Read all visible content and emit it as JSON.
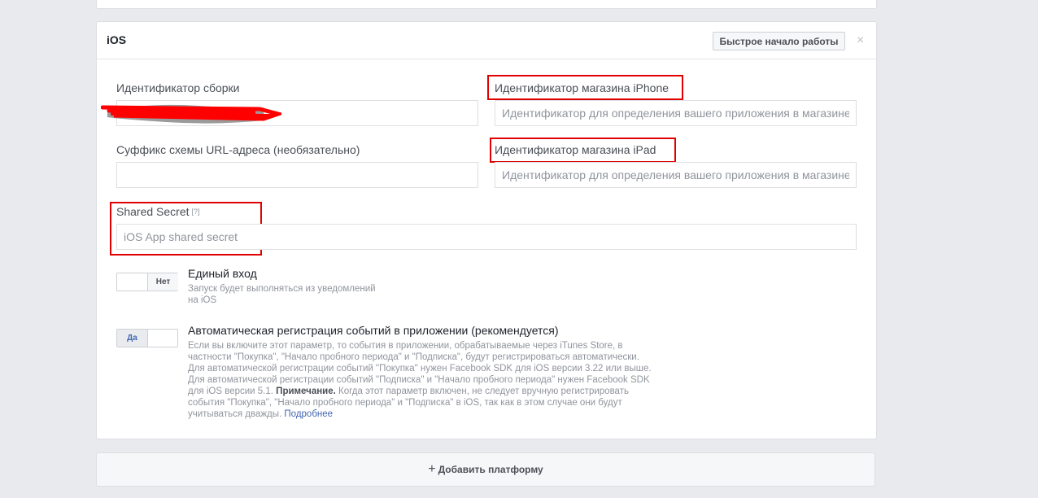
{
  "platform": {
    "title": "iOS",
    "quickstart_label": "Быстрое начало работы",
    "close_glyph": "×"
  },
  "fields": {
    "bundle_id": {
      "label": "Идентификатор сборки",
      "value": ""
    },
    "iphone_store_id": {
      "label": "Идентификатор магазина iPhone",
      "placeholder": "Идентификатор для определения вашего приложения в магазине"
    },
    "url_scheme_suffix": {
      "label": "Суффикс схемы URL-адреса (необязательно)",
      "value": ""
    },
    "ipad_store_id": {
      "label": "Идентификатор магазина iPad",
      "placeholder": "Идентификатор для определения вашего приложения в магазине"
    },
    "shared_secret": {
      "label": "Shared Secret",
      "help": "[?]",
      "placeholder": "iOS App shared secret"
    }
  },
  "single_sign_on": {
    "toggle_label": "Нет",
    "state": "off",
    "title": "Единый вход",
    "desc_line1": "Запуск будет выполняться из уведомлений",
    "desc_line2": "на iOS"
  },
  "auto_log_events": {
    "toggle_label": "Да",
    "state": "on",
    "title": "Автоматическая регистрация событий в приложении (рекомендуется)",
    "desc_lines": [
      "Если вы включите этот параметр, то события в приложении, обрабатываемые через iTunes Store, в",
      "частности \"Покупка\", \"Начало пробного периода\" и \"Подписка\", будут регистрироваться автоматически.",
      "Для автоматической регистрации событий \"Покупка\" нужен Facebook SDK для iOS версии 3.22 или выше.",
      "Для автоматической регистрации событий \"Подписка\" и \"Начало пробного периода\" нужен Facebook SDK"
    ],
    "line5_pre": "для iOS версии 5.1.",
    "note_label": "Примечание.",
    "line5_post": "Когда этот параметр включен, не следует вручную регистрировать",
    "line6": "события \"Покупка\", \"Начало пробного периода\" и \"Подписка\" в iOS, так как в этом случае они будут",
    "line7": "учитываться дважды.",
    "learn_more": "Подробнее"
  },
  "add_platform": {
    "plus": "+",
    "label": "Добавить платформу"
  },
  "colors": {
    "annotation_red": "#e00000",
    "link_blue": "#4267b2",
    "background": "#e9eaed"
  }
}
